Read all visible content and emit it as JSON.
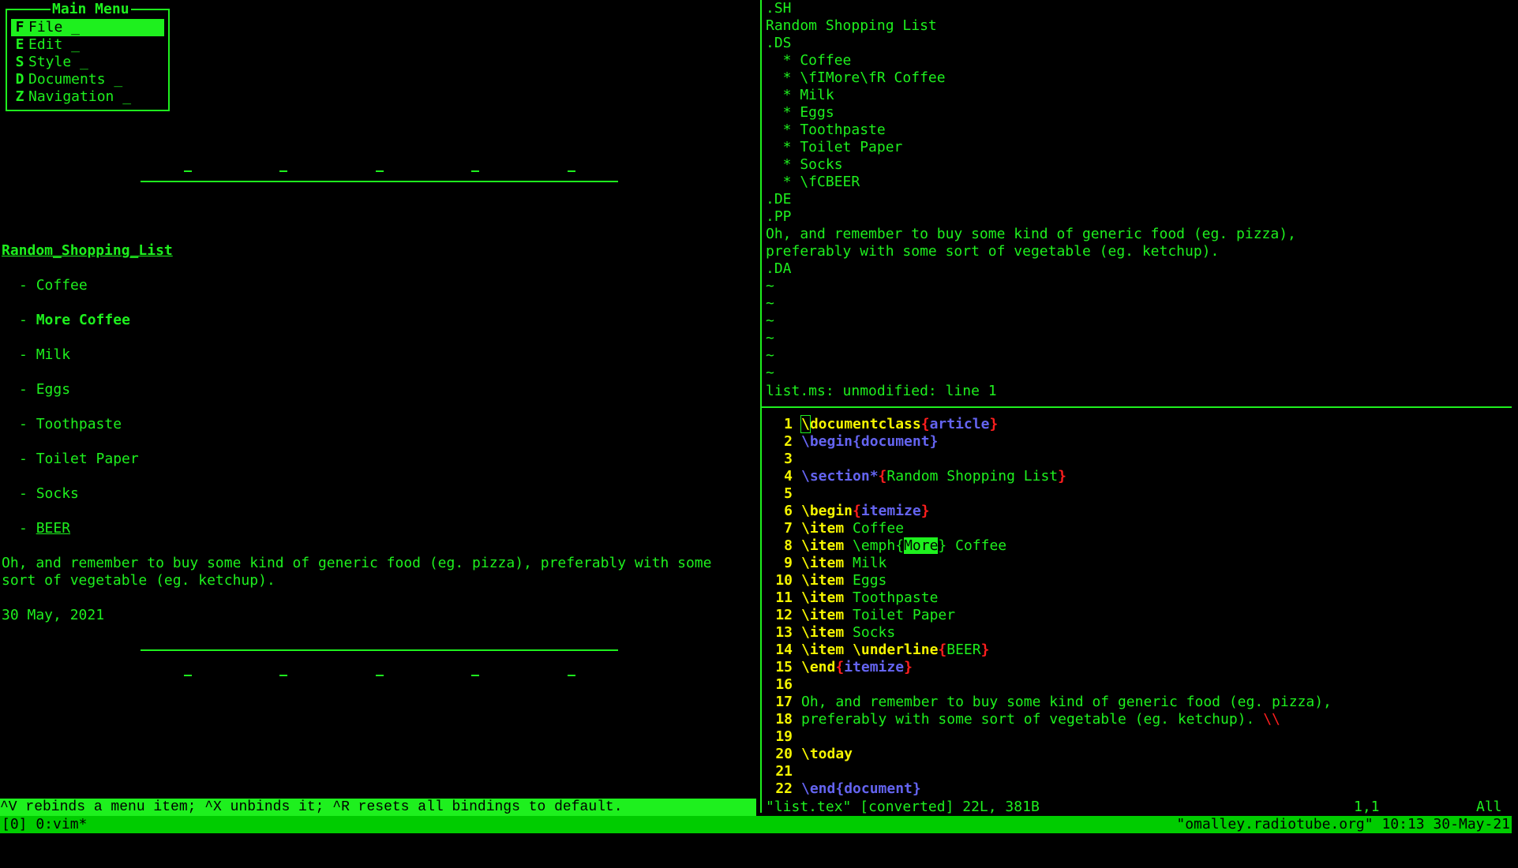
{
  "left_pane": {
    "menu": {
      "title": "Main Menu",
      "items": [
        {
          "key": "F",
          "label": "File _",
          "selected": true
        },
        {
          "key": "E",
          "label": "Edit _",
          "selected": false
        },
        {
          "key": "S",
          "label": "Style _",
          "selected": false
        },
        {
          "key": "D",
          "label": "Documents _",
          "selected": false
        },
        {
          "key": "Z",
          "label": "Navigation _",
          "selected": false
        }
      ]
    },
    "document": {
      "heading": "Random_Shopping_List",
      "bullet": "- ",
      "items": [
        "Coffee",
        "More",
        "Milk",
        "Eggs",
        "Toothpaste",
        "Toilet Paper",
        "Socks",
        "BEER"
      ],
      "more_coffee_rest": " Coffee",
      "paragraph_line1": "Oh, and remember to buy some kind of generic food (eg. pizza), preferably with some",
      "paragraph_line2": "sort of vegetable (eg. ketchup).",
      "date": "30 May, 2021"
    },
    "help_bar": "^V rebinds a menu item; ^X unbinds it; ^R resets all bindings to default."
  },
  "top_right_pane": {
    "lines": [
      ".SH",
      "Random Shopping List",
      ".DS",
      "  * Coffee",
      "  * \\fIMore\\fR Coffee",
      "  * Milk",
      "  * Eggs",
      "  * Toothpaste",
      "  * Toilet Paper",
      "  * Socks",
      "  * \\fCBEER",
      ".DE",
      ".PP",
      "Oh, and remember to buy some kind of generic food (eg. pizza),",
      "preferably with some sort of vegetable (eg. ketchup).",
      ".DA",
      "~",
      "~",
      "~",
      "~",
      "~",
      "~"
    ],
    "status": "list.ms: unmodified: line 1"
  },
  "bottom_right_pane": {
    "line_numbers": [
      "1",
      "2",
      "3",
      "4",
      "5",
      "6",
      "7",
      "8",
      "9",
      "10",
      "11",
      "12",
      "13",
      "14",
      "15",
      "16",
      "17",
      "18",
      "19",
      "20",
      "21",
      "22"
    ],
    "tokens": {
      "documentclass": "documentclass",
      "backslash": "\\",
      "article": "article",
      "begin": "\\begin",
      "document": "document",
      "section": "\\section*",
      "section_title": "Random Shopping List",
      "itemize": "itemize",
      "item": "\\item",
      "emph": "\\emph",
      "more": "More",
      "coffee": " Coffee",
      "underline": "\\underline",
      "beer": "BEER",
      "end": "\\end",
      "today": "\\today",
      "lbrace": "{",
      "rbrace": "}",
      "newline": "\\\\"
    },
    "items": [
      "Coffee",
      "Milk",
      "Eggs",
      "Toothpaste",
      "Toilet Paper",
      "Socks"
    ],
    "para1": "Oh, and remember to buy some kind of generic food (eg. pizza),",
    "para2": "preferably with some sort of vegetable (eg. ketchup). ",
    "status_file": "\"list.tex\" [converted] 22L, 381B",
    "status_pos": "1,1",
    "status_scroll": "All"
  },
  "tmux": {
    "left": "[0] 0:vim*",
    "right": "\"omalley.radiotube.org\" 10:13 30-May-21"
  },
  "colors": {
    "terminal_green": "#1ef01e",
    "tmux_green": "#00cc00",
    "keyword_yellow": "#f5f500",
    "env_blue": "#6464f0",
    "brace_red": "#ff1e1e"
  }
}
